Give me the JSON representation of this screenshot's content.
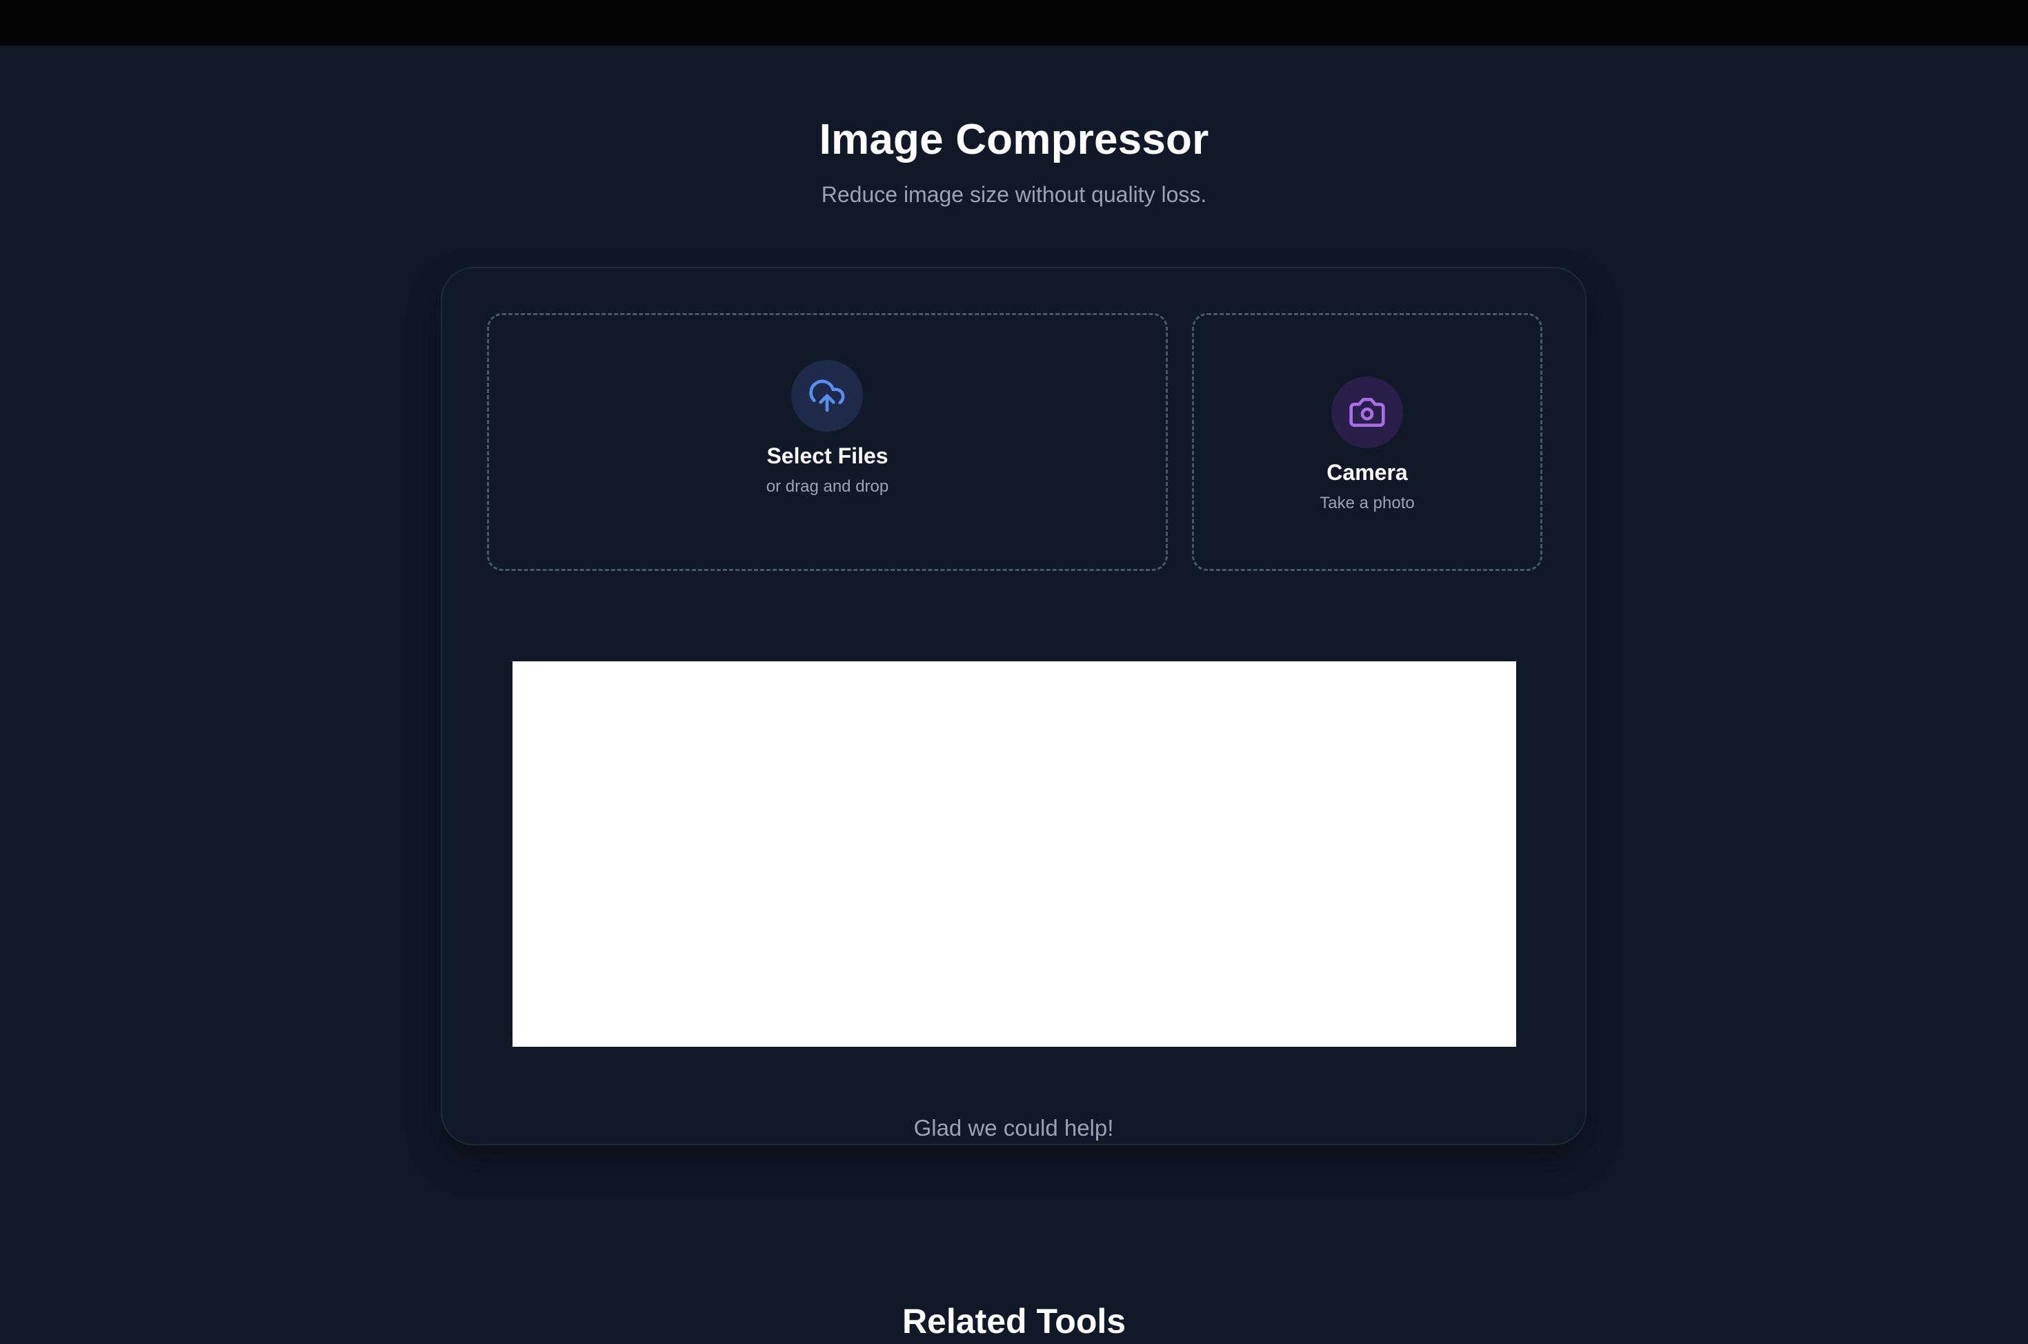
{
  "header": {
    "title": "Image Compressor",
    "subtitle": "Reduce image size without quality loss."
  },
  "upload": {
    "files": {
      "label": "Select Files",
      "sub": "or drag and drop",
      "icon": "cloud-upload-icon"
    },
    "camera": {
      "label": "Camera",
      "sub": "Take a photo",
      "icon": "camera-icon"
    }
  },
  "result": {
    "thanks": "Glad we could help!"
  },
  "related": {
    "title": "Related Tools"
  },
  "colors": {
    "background": "#111827",
    "accent_blue": "#5b8def",
    "accent_purple": "#a86ee6"
  }
}
